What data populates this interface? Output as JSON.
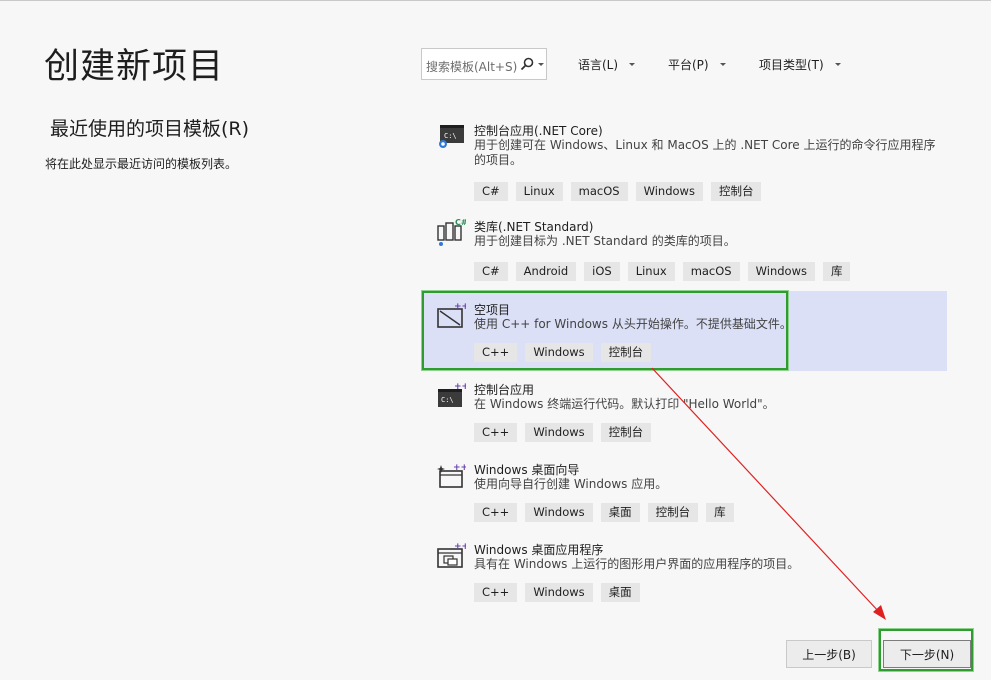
{
  "page": {
    "title": "创建新项目",
    "recent_title": "最近使用的项目模板(R)",
    "recent_desc": "将在此处显示最近访问的模板列表。"
  },
  "search": {
    "placeholder": "搜索模板(Alt+S)",
    "icon": "search-icon"
  },
  "filters": [
    {
      "label": "语言(L)"
    },
    {
      "label": "平台(P)"
    },
    {
      "label": "项目类型(T)"
    }
  ],
  "templates": [
    {
      "name": "控制台应用(.NET Core)",
      "desc": "用于创建可在 Windows、Linux 和 MacOS 上的 .NET Core 上运行的命令行应用程序的项目。",
      "tags": [
        "C#",
        "Linux",
        "macOS",
        "Windows",
        "控制台"
      ],
      "icon": "console-dotnet-icon"
    },
    {
      "name": "类库(.NET Standard)",
      "desc": "用于创建目标为 .NET Standard 的类库的项目。",
      "tags": [
        "C#",
        "Android",
        "iOS",
        "Linux",
        "macOS",
        "Windows",
        "库"
      ],
      "icon": "class-library-icon"
    },
    {
      "name": "空项目",
      "desc": "使用 C++ for Windows 从头开始操作。不提供基础文件。",
      "tags": [
        "C++",
        "Windows",
        "控制台"
      ],
      "icon": "empty-project-icon",
      "selected": true
    },
    {
      "name": "控制台应用",
      "desc": "在 Windows 终端运行代码。默认打印 \"Hello World\"。",
      "tags": [
        "C++",
        "Windows",
        "控制台"
      ],
      "icon": "console-cpp-icon"
    },
    {
      "name": "Windows 桌面向导",
      "desc": "使用向导自行创建 Windows 应用。",
      "tags": [
        "C++",
        "Windows",
        "桌面",
        "控制台",
        "库"
      ],
      "icon": "desktop-wizard-icon"
    },
    {
      "name": "Windows 桌面应用程序",
      "desc": "具有在 Windows 上运行的图形用户界面的应用程序的项目。",
      "tags": [
        "C++",
        "Windows",
        "桌面"
      ],
      "icon": "desktop-app-icon"
    }
  ],
  "buttons": {
    "back": "上一步(B)",
    "next": "下一步(N)"
  },
  "colors": {
    "selected_bg": "#dbe0f7",
    "highlight": "#2e9c2e",
    "arrow": "#e02020"
  }
}
